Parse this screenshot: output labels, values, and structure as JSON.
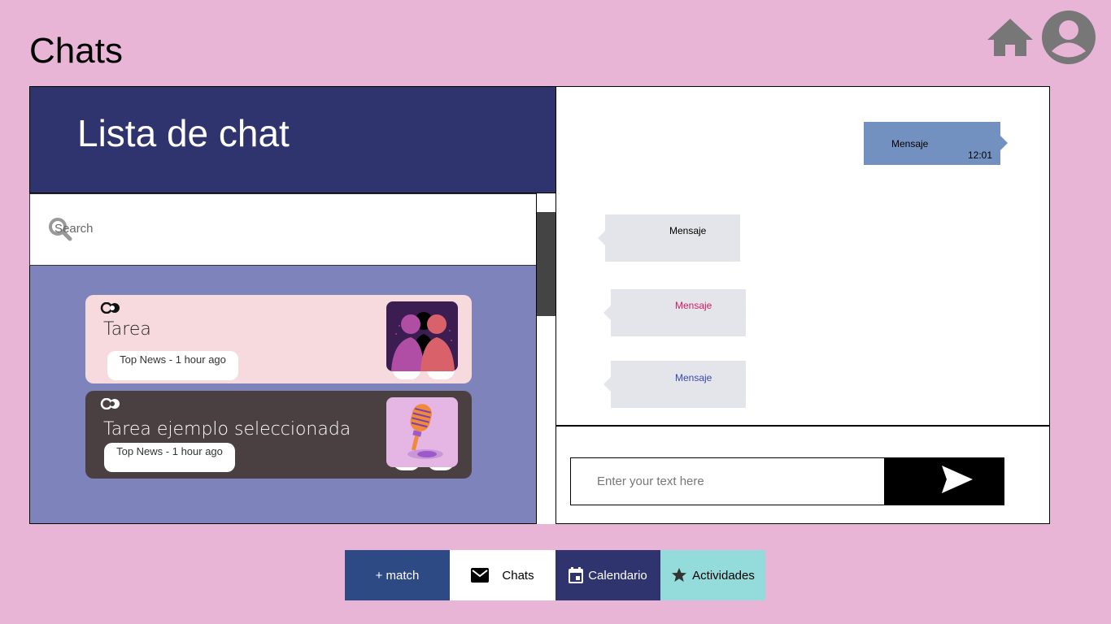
{
  "page": {
    "title": "Chats"
  },
  "top_icons": [
    "home-icon",
    "account-icon"
  ],
  "chat_list": {
    "title": "Lista de chat",
    "search_placeholder": "Search",
    "items": [
      {
        "title": "Tarea",
        "tag": "Top News - 1 hour ago",
        "thumbnail": "silhouettes-image",
        "selected": false
      },
      {
        "title": "Tarea ejemplo seleccionada",
        "tag": "Top News - 1 hour ago",
        "thumbnail": "microphone-image",
        "selected": true
      }
    ]
  },
  "messages": [
    {
      "text": "Mensaje",
      "time": "12:01",
      "direction": "outgoing",
      "color": "#000000"
    },
    {
      "text": "Mensaje",
      "direction": "incoming",
      "color": "#000000"
    },
    {
      "text": "Mensaje",
      "direction": "incoming",
      "color": "#d81b60"
    },
    {
      "text": "Mensaje",
      "direction": "incoming",
      "color": "#3949ab"
    }
  ],
  "composer": {
    "placeholder": "Enter your text here",
    "send_icon": "send-icon"
  },
  "nav": {
    "match_label": "+ match",
    "chats_label": "Chats",
    "calendar_label": "Calendario",
    "activities_label": "Actividades"
  },
  "colors": {
    "background": "#e9b5d7",
    "header": "#30346e",
    "list_bg": "#7e83bc",
    "outgoing_bubble": "#7391c0",
    "incoming_bubble": "#e3e5ea"
  }
}
